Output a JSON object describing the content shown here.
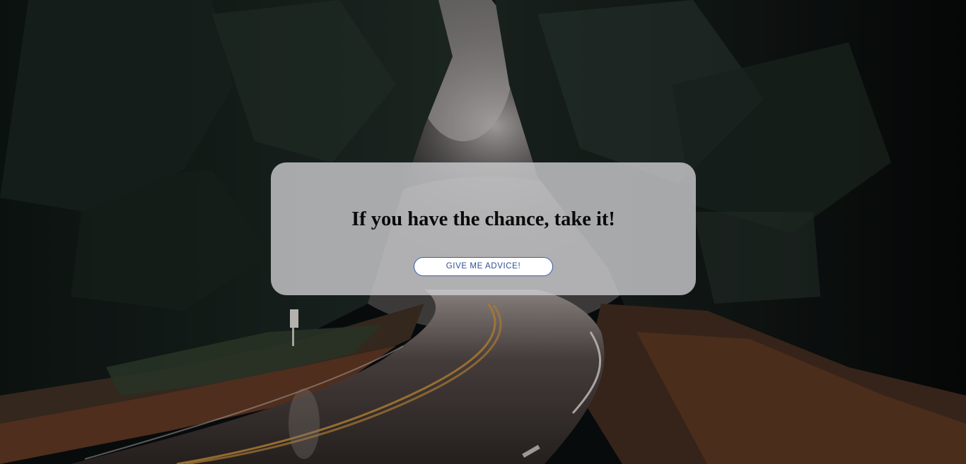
{
  "advice": {
    "text": "If you have the chance, take it!"
  },
  "actions": {
    "button_label": "GIVE ME ADVICE!"
  },
  "colors": {
    "card_background": "#cdcdd0",
    "button_border": "#3b5fa8",
    "button_text": "#2d4f97",
    "advice_text": "#0a0a0a"
  }
}
